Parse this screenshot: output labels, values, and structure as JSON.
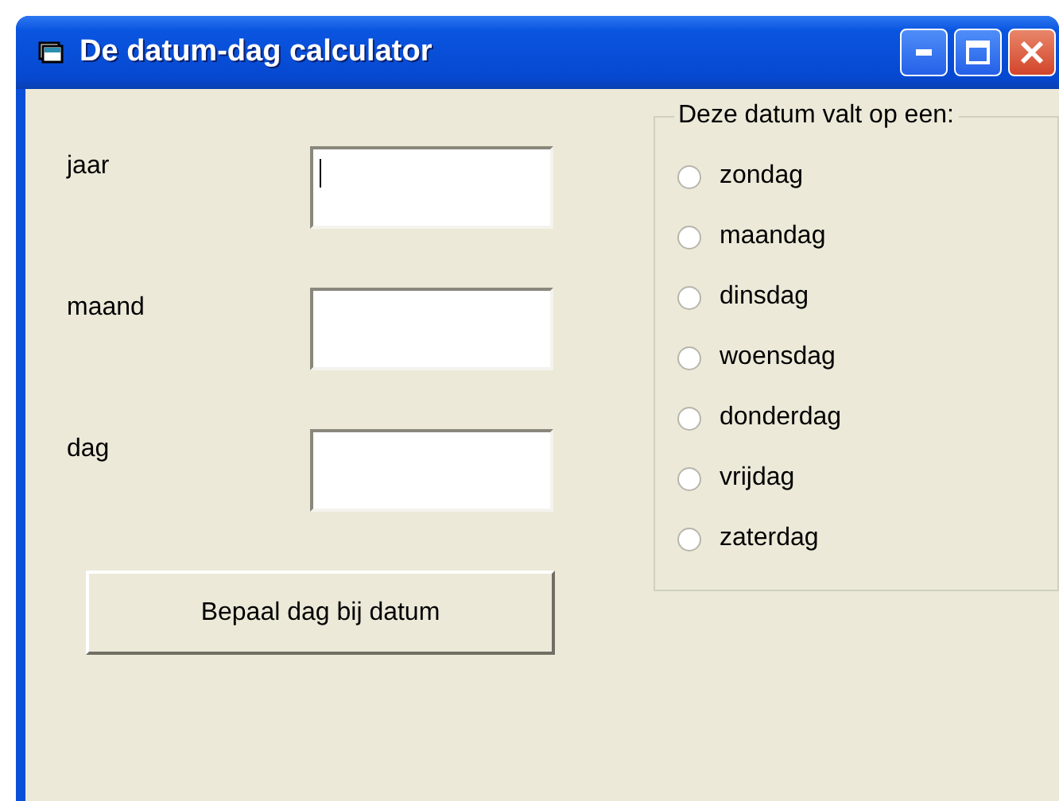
{
  "window": {
    "title": "De datum-dag calculator"
  },
  "fields": [
    {
      "label": "jaar",
      "focused": true
    },
    {
      "label": "maand",
      "focused": false
    },
    {
      "label": "dag",
      "focused": false
    }
  ],
  "button": {
    "label": "Bepaal dag bij datum"
  },
  "group": {
    "title": "Deze datum valt op een:",
    "options": [
      {
        "label": "zondag",
        "selected": false
      },
      {
        "label": "maandag",
        "selected": false
      },
      {
        "label": "dinsdag",
        "selected": false
      },
      {
        "label": "woensdag",
        "selected": false
      },
      {
        "label": "donderdag",
        "selected": false
      },
      {
        "label": "vrijdag",
        "selected": false
      },
      {
        "label": "zaterdag",
        "selected": false
      }
    ]
  }
}
